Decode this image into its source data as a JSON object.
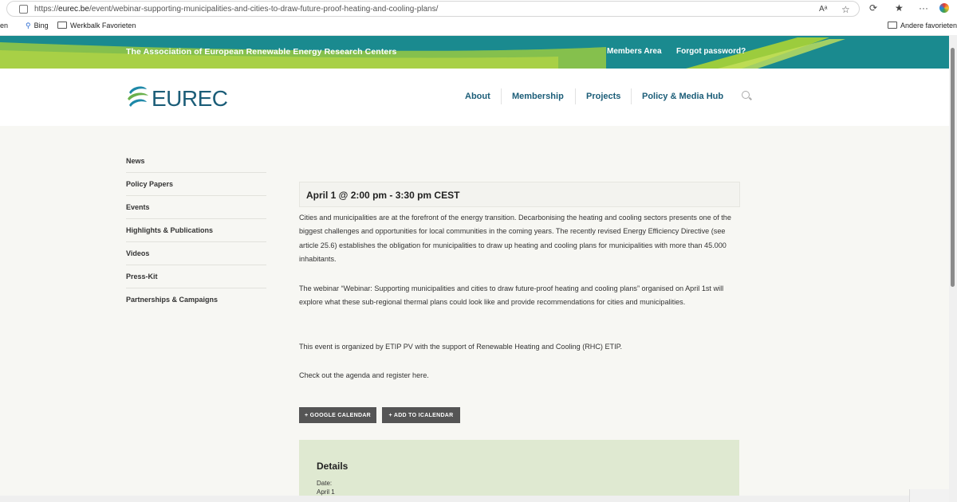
{
  "browser": {
    "url_prefix": "https://",
    "url_domain": "eurec.be",
    "url_path": "/event/webinar-supporting-municipalities-and-cities-to-draw-future-proof-heating-and-cooling-plans/",
    "favorites": [
      "en",
      "Bing",
      "Werkbalk Favorieten"
    ],
    "other_favorites": "Andere favorieten"
  },
  "banner": {
    "association": "The Association of European Renewable Energy Research Centers",
    "members_area": "Members Area",
    "forgot_password": "Forgot password?"
  },
  "header": {
    "logo_text": "EUREC",
    "nav": [
      "About",
      "Membership",
      "Projects",
      "Policy & Media Hub"
    ]
  },
  "sidebar": {
    "items": [
      "News",
      "Policy Papers",
      "Events",
      "Highlights & Publications",
      "Videos",
      "Press-Kit",
      "Partnerships & Campaigns"
    ]
  },
  "event": {
    "date": "April 1 @ 2:00 pm - 3:30 pm CEST",
    "paragraphs": [
      "Cities and municipalities are at the forefront of the energy transition. Decarbonising the heating and cooling sectors presents one of the biggest challenges and opportunities for local communities in the coming years. The recently revised Energy Efficiency Directive (see article 25.6) establishes the obligation for municipalities to draw up heating and cooling plans for municipalities with more than 45.000 inhabitants.",
      "The webinar “Webinar: Supporting municipalities and cities to draw future-proof heating and cooling plans” organised on April 1st will explore what these sub-regional thermal plans could look like and provide recommendations for cities and municipalities.",
      "This event is organized by ETIP PV with the support of Renewable Heating and Cooling (RHC) ETIP.",
      "Check out the agenda and register here."
    ],
    "google_calendar": "+ GOOGLE CALENDAR",
    "icalendar": "+ ADD TO ICALENDAR",
    "details_title": "Details",
    "date_label": "Date:",
    "date_value": "April 1"
  }
}
